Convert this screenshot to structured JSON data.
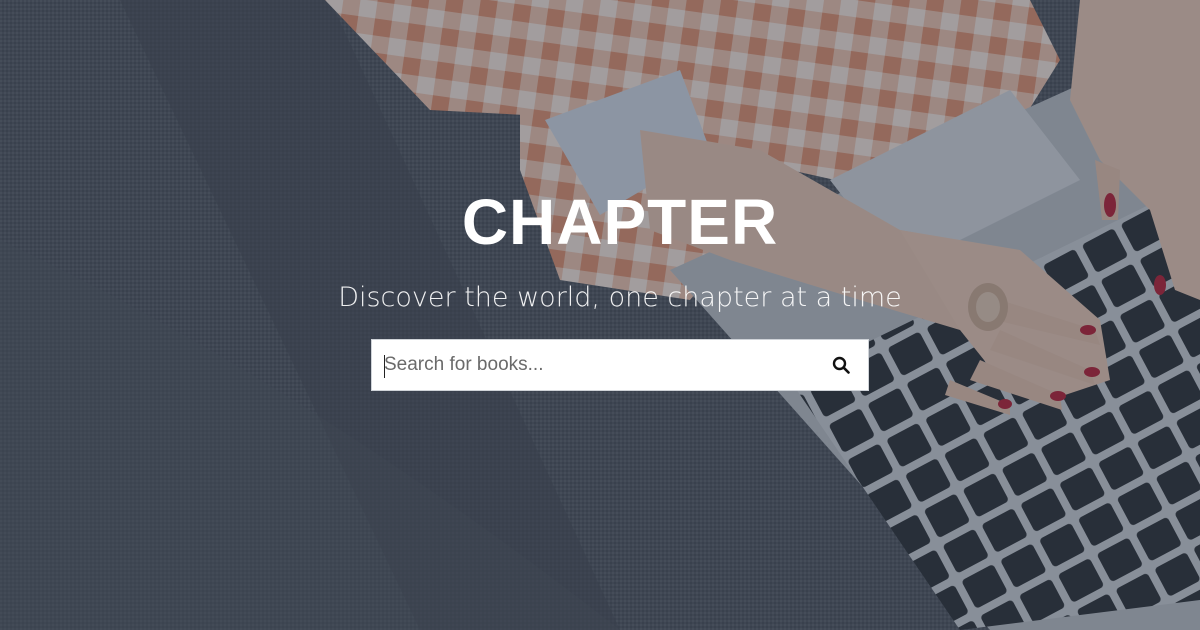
{
  "hero": {
    "title": "CHAPTER",
    "tagline": "Discover the world, one chapter at a time"
  },
  "search": {
    "placeholder": "Search for books...",
    "value": "",
    "button_icon": "search-icon"
  },
  "colors": {
    "overlay": "#303c4c",
    "title_text": "#ffffff",
    "search_background": "#ffffff"
  }
}
